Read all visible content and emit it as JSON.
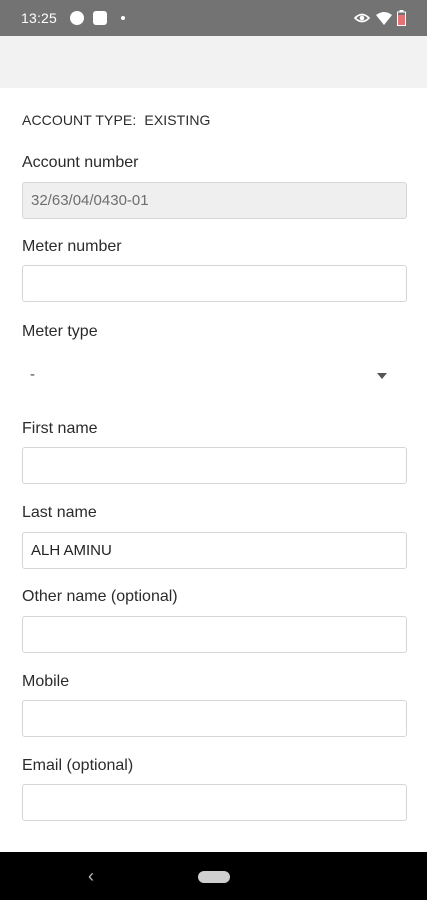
{
  "status_bar": {
    "time": "13:25"
  },
  "form": {
    "account_type_label": "ACCOUNT TYPE:",
    "account_type_value": "EXISTING",
    "account_number": {
      "label": "Account number",
      "value": "32/63/04/0430-01"
    },
    "meter_number": {
      "label": "Meter number",
      "value": ""
    },
    "meter_type": {
      "label": "Meter type",
      "value": "-"
    },
    "first_name": {
      "label": "First name",
      "value": ""
    },
    "last_name": {
      "label": "Last name",
      "value": "ALH AMINU"
    },
    "other_name": {
      "label": "Other name (optional)",
      "value": ""
    },
    "mobile": {
      "label": "Mobile",
      "value": ""
    },
    "email": {
      "label": "Email (optional)",
      "value": ""
    }
  },
  "nav": {
    "back_symbol": "‹"
  }
}
